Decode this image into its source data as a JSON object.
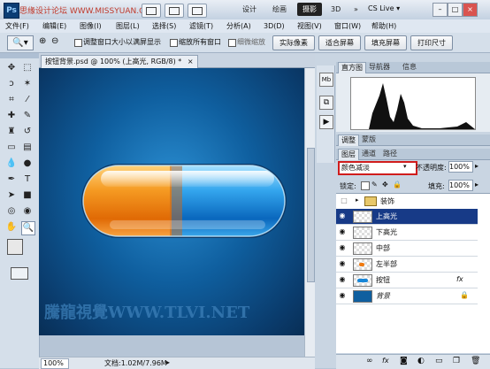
{
  "titlebar": {
    "logo": "Ps",
    "watermark": "思缘设计论坛 WWW.MISSYUAN.COM",
    "workspaces": [
      "设计",
      "绘画",
      "摄影",
      "3D"
    ],
    "active_workspace": "摄影",
    "more": "»",
    "cs_live": "CS Live ▾",
    "win_buttons": [
      "–",
      "□",
      "×"
    ]
  },
  "menu": [
    "文件(F)",
    "编辑(E)",
    "图像(I)",
    "图层(L)",
    "选择(S)",
    "滤镜(T)",
    "分析(A)",
    "3D(D)",
    "视图(V)",
    "窗口(W)",
    "帮助(H)"
  ],
  "options": {
    "resize_windows": "调整窗口大小以满屏显示",
    "zoom_all": "缩放所有窗口",
    "scrubby": "细微缩放",
    "actual_pixels": "实际像素",
    "fit_screen": "适合屏幕",
    "fill_screen": "填充屏幕",
    "print_size": "打印尺寸"
  },
  "document": {
    "tab_label": "按钮背景.psd @ 100% (上高光, RGB/8) *",
    "close": "×",
    "watermark": "騰龍視覺WWW.TLVI.NET",
    "zoom": "100%",
    "doc_size": "文档:1.02M/7.96M"
  },
  "panels": {
    "top_tabs": [
      "直方图",
      "导航器",
      "信息"
    ],
    "adjust_tabs": [
      "调整",
      "蒙版"
    ],
    "layer_tabs": [
      "图层",
      "通道",
      "路径"
    ],
    "blend_mode": "颜色减淡",
    "opacity_label": "不透明度:",
    "opacity_value": "100%",
    "lock_label": "锁定:",
    "fill_label": "填充:",
    "fill_value": "100%",
    "group_name": "装饰",
    "layers": [
      {
        "name": "上高光",
        "selected": true
      },
      {
        "name": "下高光",
        "selected": false
      },
      {
        "name": "中部",
        "selected": false
      },
      {
        "name": "左半部",
        "selected": false
      },
      {
        "name": "按钮",
        "selected": false
      },
      {
        "name": "背景",
        "selected": false
      }
    ],
    "fx": "fx"
  },
  "colors": {
    "pill_orange": "#f07a10",
    "pill_blue": "#1786d8",
    "canvas_bg": "#0f5f9f",
    "selected_layer": "#173a87"
  }
}
